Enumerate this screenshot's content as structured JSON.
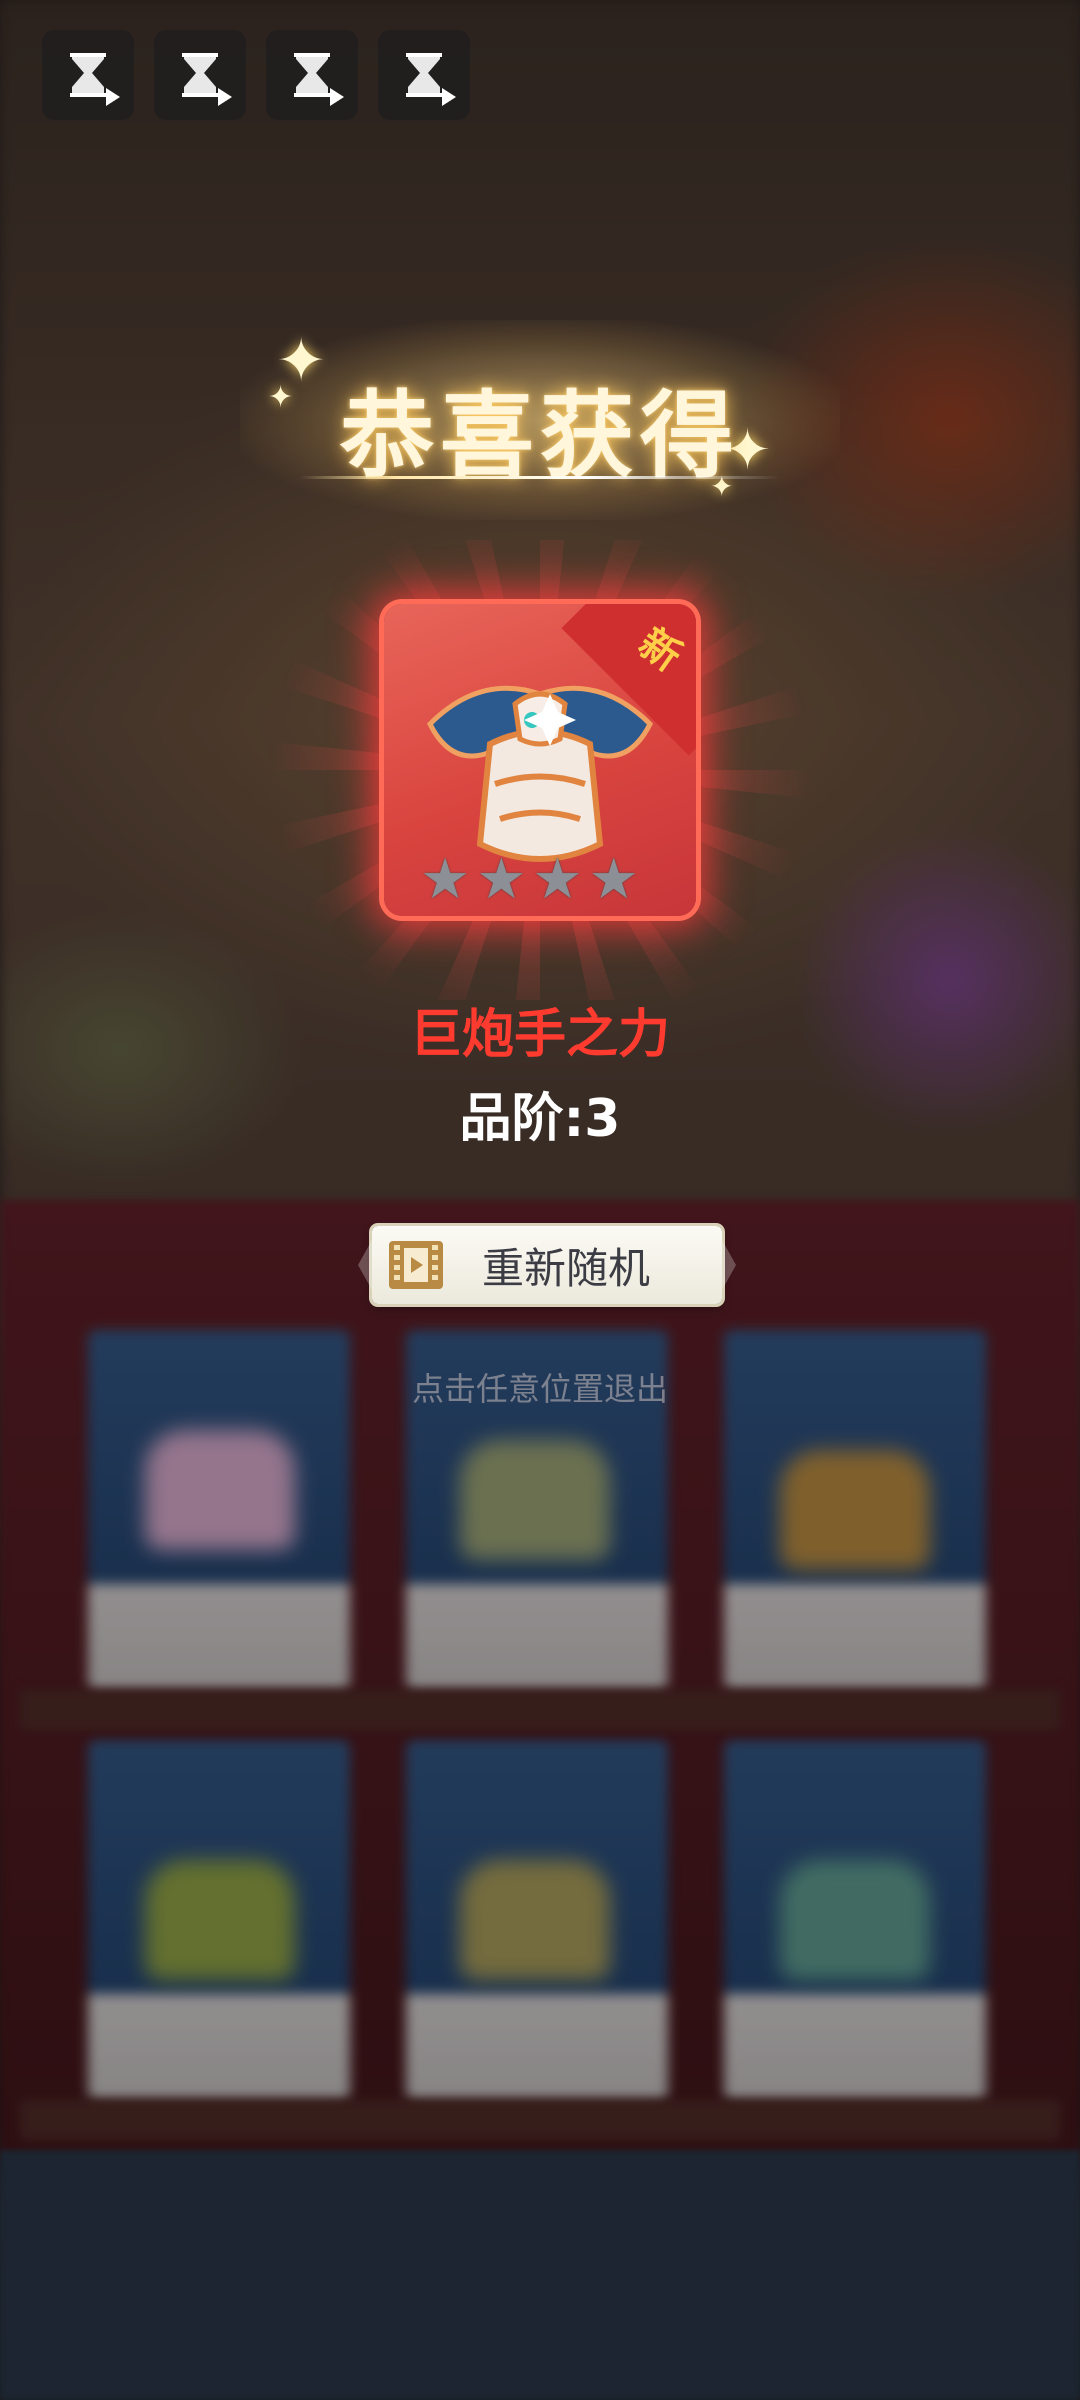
{
  "top_bar": {
    "buttons": [
      {
        "icon": "hourglass-video-icon"
      },
      {
        "icon": "hourglass-video-icon"
      },
      {
        "icon": "hourglass-video-icon"
      },
      {
        "icon": "hourglass-video-icon"
      }
    ]
  },
  "dialog": {
    "title": "恭喜获得",
    "item": {
      "badge": "新",
      "name": "巨炮手之力",
      "grade": "品阶:3",
      "stars_total": 4,
      "stars_filled": 0,
      "name_color": "#ff3b30",
      "card_color": "#d9443f"
    },
    "reroll_button": {
      "label": "重新随机",
      "icon": "video-film-icon"
    },
    "exit_hint": "点击任意位置退出"
  }
}
